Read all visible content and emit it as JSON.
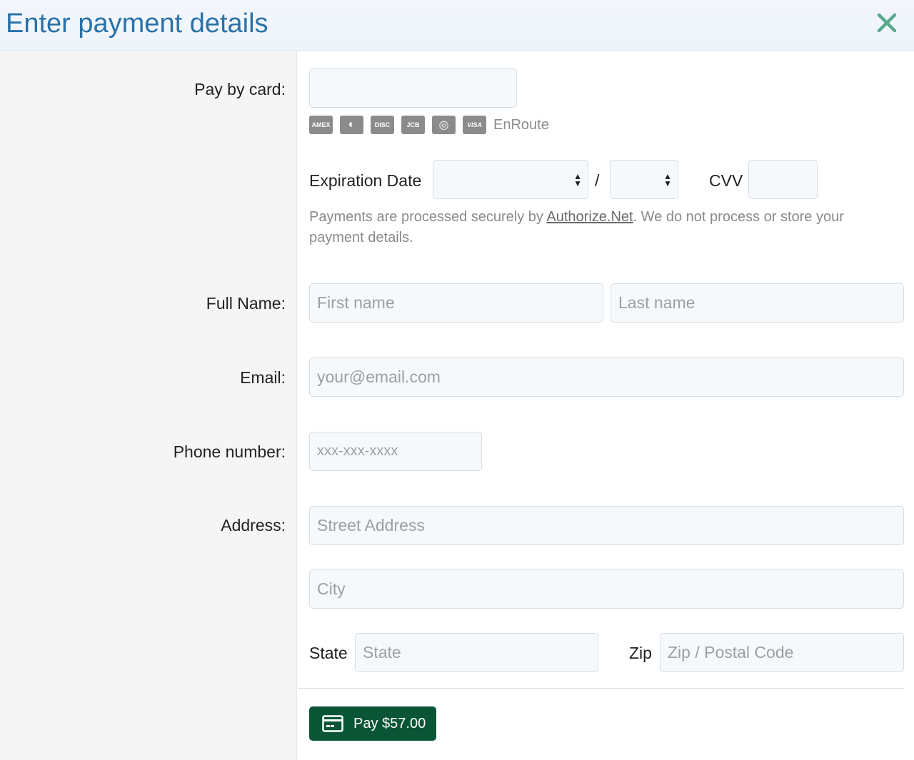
{
  "header": {
    "title": "Enter payment details",
    "close_icon": "close-icon",
    "accent": "#2a72a8",
    "close_color": "#5aaa8c"
  },
  "labels": {
    "pay_by_card": "Pay by card:",
    "full_name": "Full Name:",
    "email": "Email:",
    "phone": "Phone number:",
    "address": "Address:"
  },
  "card": {
    "number_value": "",
    "brands": [
      "AMERICAN EXPRESS",
      "DINERS",
      "DISCOVER",
      "JCB",
      "MASTERCARD",
      "VISA"
    ],
    "brand_short": [
      "AMEX",
      "◐",
      "DISC",
      "JCB",
      "◎",
      "VISA"
    ],
    "enroute": "EnRoute",
    "expiration_label": "Expiration Date",
    "month_value": "",
    "slash": "/",
    "year_value": "",
    "cvv_label": "CVV",
    "cvv_value": ""
  },
  "note": {
    "prefix": "Payments are processed securely by ",
    "link": "Authorize.Net",
    "suffix": ". We do not process or store your payment details."
  },
  "placeholders": {
    "first_name": "First name",
    "last_name": "Last name",
    "email": "your@email.com",
    "phone": "xxx-xxx-xxxx",
    "street": "Street Address",
    "city": "City",
    "state": "State",
    "zip": "Zip / Postal Code"
  },
  "address": {
    "state_label": "State",
    "zip_label": "Zip"
  },
  "pay_button": {
    "label": "Pay $57.00",
    "icon": "credit-card-icon",
    "color": "#0b5537"
  }
}
